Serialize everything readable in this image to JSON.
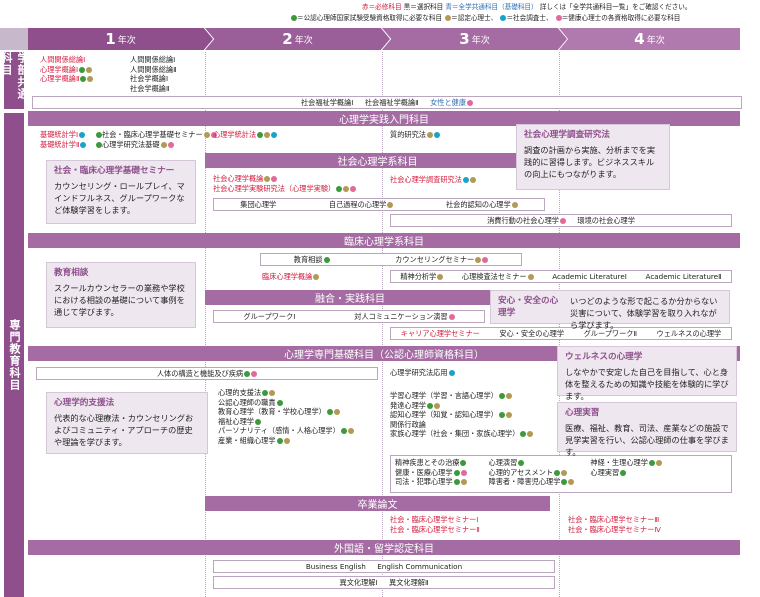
{
  "legend": {
    "line1_red": "赤＝必修科目",
    "line1_black": "黒＝選択科目",
    "line1_blue": "青＝全学共通科目（基礎科目）",
    "line1_rest": "詳しくは「全学共通科目一覧」をご確認ください。",
    "line2_g": "＝公認心理師国家試験受験資格取得に必要な科目",
    "line2_o": "＝認定心理士、",
    "line2_b": "＝社会調査士、",
    "line2_p": "＝健康心理士の各資格取得に必要な科目"
  },
  "years": [
    {
      "num": "1",
      "label": "年次"
    },
    {
      "num": "2",
      "label": "年次"
    },
    {
      "num": "3",
      "label": "年次"
    },
    {
      "num": "4",
      "label": "年次"
    }
  ],
  "side": {
    "common": "学部共通科目",
    "major": "専門教育科目"
  },
  "common": {
    "col1": [
      "人間関係総論Ⅰ",
      "心理学概論Ⅰ",
      "心理学概論Ⅱ"
    ],
    "col2": [
      "人間関係総論Ⅰ",
      "人間関係総論Ⅱ",
      "社会学概論Ⅰ",
      "社会学概論Ⅱ"
    ],
    "bar": [
      "社会福祉学概論Ⅰ",
      "社会福祉学概論Ⅱ",
      "女性と健康"
    ]
  },
  "sections": {
    "practice": "心理学実践入門科目",
    "social": "社会心理学系科目",
    "clinical": "臨床心理学系科目",
    "fusion": "融合・実践科目",
    "foundation": "心理学専門基礎科目（公認心理師資格科目）",
    "thesis": "卒業論文",
    "foreign": "外国語・留学認定科目"
  },
  "practice": {
    "y1a": [
      "基礎統計学Ⅰ",
      "基礎統計学Ⅱ"
    ],
    "y1b": [
      "社会・臨床心理学基礎セミナー",
      "心理学研究法基礎"
    ],
    "y2": "心理学統計法",
    "y3": "質的研究法"
  },
  "social": {
    "y2": [
      "社会心理学概論",
      "社会心理学実験研究法（心理学実験）"
    ],
    "y3": "社会心理学調査研究法",
    "row2": [
      "集団心理学",
      "自己過程の心理学",
      "社会的認知の心理学"
    ],
    "row3": [
      "消費行動の社会心理学",
      "環境の社会心理学"
    ]
  },
  "clinical": {
    "row1": [
      "教育相談",
      "カウンセリングセミナー"
    ],
    "y2": "臨床心理学概論",
    "row2": [
      "精神分析学",
      "心理検査法セミナー",
      "Academic LiteratureⅠ",
      "Academic LiteratureⅡ"
    ]
  },
  "fusion": {
    "row1": [
      "グループワークⅠ",
      "対人コミュニケーション演習"
    ],
    "row2": [
      "キャリア心理学セミナー",
      "安心・安全の心理学",
      "グループワークⅡ",
      "ウェルネスの心理学"
    ]
  },
  "foundation": {
    "bar1": "人体の構造と機能及び疾病",
    "y3top": "心理学研究法応用",
    "y2list": [
      "心理的支援法",
      "公認心理師の職責",
      "教育心理学（教育・学校心理学）",
      "福祉心理学",
      "パーソナリティ（感情・人格心理学）",
      "産業・組織心理学"
    ],
    "y3list": [
      "学習心理学（学習・言語心理学）",
      "発達心理学",
      "認知心理学（知覚・認知心理学）",
      "関係行政論",
      "家族心理学（社会・集団・家族心理学）"
    ],
    "lowA": [
      "精神疾患とその治療",
      "健康・医療心理学",
      "司法・犯罪心理学"
    ],
    "lowB": [
      "心理演習",
      "心理的アセスメント",
      "障害者・障害児心理学"
    ],
    "lowC": [
      "神経・生理心理学",
      "心理実習"
    ]
  },
  "thesis": {
    "y3": [
      "社会・臨床心理学セミナーⅠ",
      "社会・臨床心理学セミナーⅡ"
    ],
    "y4": [
      "社会・臨床心理学セミナーⅢ",
      "社会・臨床心理学セミナーⅣ"
    ]
  },
  "foreign": {
    "bar1": [
      "Business English",
      "English Communication"
    ],
    "bar2": [
      "異文化理解Ⅰ",
      "異文化理解Ⅱ"
    ]
  },
  "callouts": [
    {
      "title": "社会心理学調査研究法",
      "body": "調査の計画から実施、分析までを実践的に習得します。ビジネススキルの向上にもつながります。"
    },
    {
      "title": "社会・臨床心理学基礎セミナー",
      "body": "カウンセリング・ロールプレイ、マインドフルネス、グループワークなど体験学習をします。"
    },
    {
      "title": "教育相談",
      "body": "スクールカウンセラーの業務や学校における相談の基礎について事例を通じて学びます。"
    },
    {
      "title": "安心・安全の心理学",
      "body": "いつどのような形で起こるか分からない災害について、体験学習を取り入れながら学びます。"
    },
    {
      "title": "ウェルネスの心理学",
      "body": "しなやかで安定した自己を目指して、心と身体を整えるための知識や技能を体験的に学びます。"
    },
    {
      "title": "心理学的支援法",
      "body": "代表的な心理療法・カウンセリングおよびコミュニティ・アプローチの歴史や理論を学びます。"
    },
    {
      "title": "心理実習",
      "body": "医療、福祉、教育、司法、産業などの施設で見学実習を行い、公認心理師の仕事を学びます。"
    }
  ]
}
